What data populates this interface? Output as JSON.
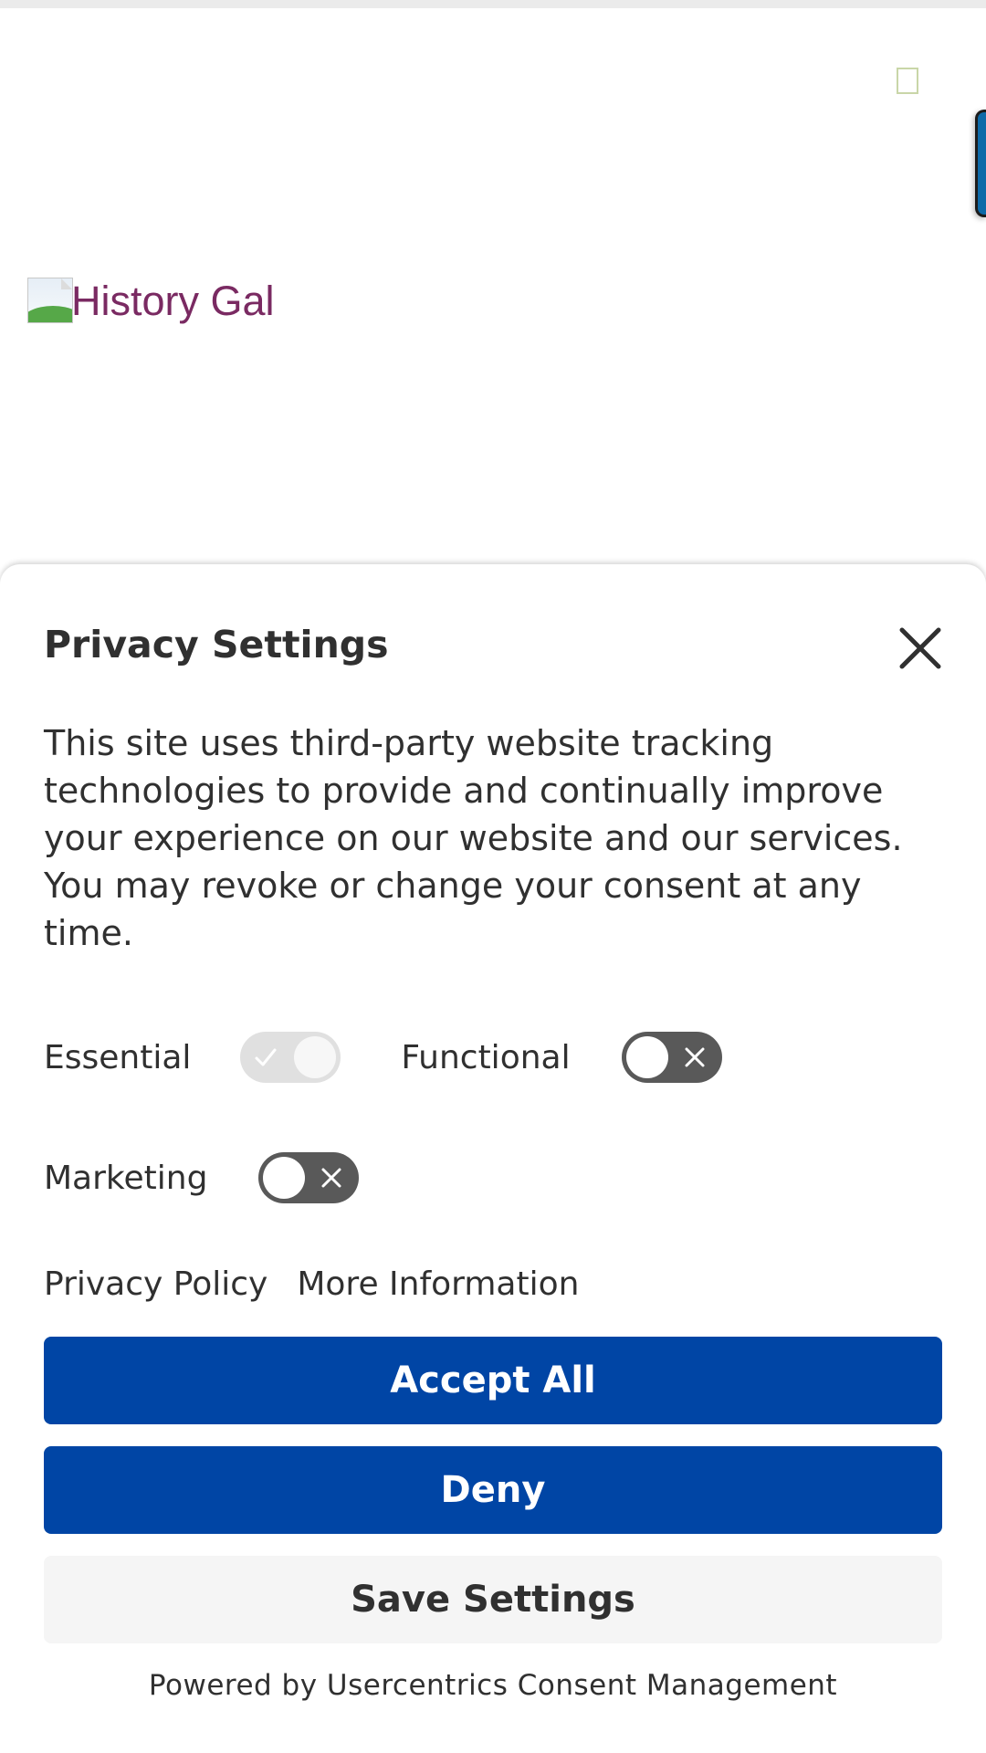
{
  "site": {
    "logo_alt": "History Gal"
  },
  "consent": {
    "title": "Privacy Settings",
    "description": "This site uses third-party website tracking technologies to provide and continually improve your experience on our website and our services. You may revoke or change your consent at any time.",
    "toggles": [
      {
        "label": "Essential",
        "state": "on-disabled"
      },
      {
        "label": "Functional",
        "state": "off"
      },
      {
        "label": "Marketing",
        "state": "off"
      }
    ],
    "links": {
      "privacy_policy": "Privacy Policy",
      "more_information": "More Information"
    },
    "buttons": {
      "accept_all": "Accept All",
      "deny": "Deny",
      "save_settings": "Save Settings"
    },
    "powered_by": "Powered by Usercentrics Consent Management"
  },
  "colors": {
    "primary_button": "#0045a5",
    "secondary_button": "#f5f5f5",
    "text": "#303030",
    "toggle_off": "#595959",
    "logo_text": "#7a2a62"
  }
}
